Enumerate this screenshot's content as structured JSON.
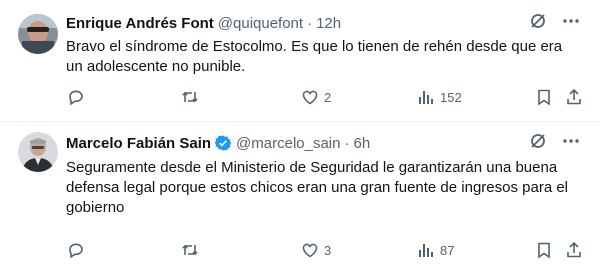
{
  "tweets": [
    {
      "author": {
        "name": "Enrique Andrés Font",
        "handle": "@quiquefont",
        "verified": false
      },
      "time": "12h",
      "text": "Bravo el síndrome de Estocolmo. Es que lo tienen de rehén desde que era un adolescente no punible.",
      "stats": {
        "likes": "2",
        "views": "152"
      }
    },
    {
      "author": {
        "name": "Marcelo Fabián Sain",
        "handle": "@marcelo_sain",
        "verified": true
      },
      "time": "6h",
      "text": "Seguramente desde el Ministerio de Seguridad le garantizarán una buena defensa legal porque estos chicos eran una gran fuente de ingresos para el gobierno",
      "stats": {
        "likes": "3",
        "views": "87"
      }
    }
  ],
  "separator": "·",
  "icons": {
    "verified_color": "#1d9bf0",
    "muted_color": "#536471"
  }
}
